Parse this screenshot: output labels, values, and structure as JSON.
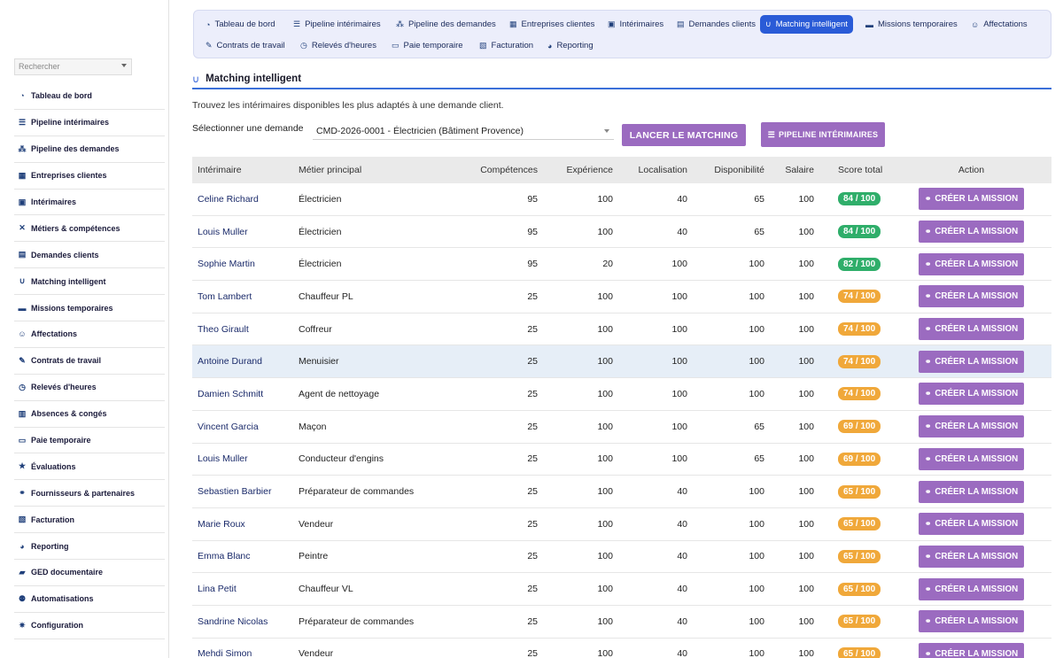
{
  "colors": {
    "accent": "#2a5bd7",
    "button": "#9b6bc0",
    "score_high": "#2fae6a",
    "score_mid": "#f0a83a"
  },
  "sidebar": {
    "search_placeholder": "Rechercher",
    "items": [
      {
        "label": "Tableau de bord",
        "icon": "dashboard-icon"
      },
      {
        "label": "Pipeline intérimaires",
        "icon": "list-icon"
      },
      {
        "label": "Pipeline des demandes",
        "icon": "flow-icon"
      },
      {
        "label": "Entreprises clientes",
        "icon": "building-icon"
      },
      {
        "label": "Intérimaires",
        "icon": "badge-icon"
      },
      {
        "label": "Métiers & compétences",
        "icon": "tools-icon"
      },
      {
        "label": "Demandes clients",
        "icon": "clipboard-icon"
      },
      {
        "label": "Matching intelligent",
        "icon": "magnet-icon"
      },
      {
        "label": "Missions temporaires",
        "icon": "briefcase-icon"
      },
      {
        "label": "Affectations",
        "icon": "user-plus-icon"
      },
      {
        "label": "Contrats de travail",
        "icon": "contract-icon"
      },
      {
        "label": "Relevés d'heures",
        "icon": "clock-icon"
      },
      {
        "label": "Absences & congés",
        "icon": "calendar-icon"
      },
      {
        "label": "Paie temporaire",
        "icon": "money-icon"
      },
      {
        "label": "Évaluations",
        "icon": "star-icon"
      },
      {
        "label": "Fournisseurs & partenaires",
        "icon": "handshake-icon"
      },
      {
        "label": "Facturation",
        "icon": "invoice-icon"
      },
      {
        "label": "Reporting",
        "icon": "pie-chart-icon"
      },
      {
        "label": "GED documentaire",
        "icon": "folder-icon"
      },
      {
        "label": "Automatisations",
        "icon": "robot-icon"
      },
      {
        "label": "Configuration",
        "icon": "gear-icon"
      }
    ]
  },
  "tabs": [
    {
      "label": "Tableau de bord",
      "icon": "dashboard-icon"
    },
    {
      "label": "Pipeline intérimaires",
      "icon": "list-icon"
    },
    {
      "label": "Pipeline des demandes",
      "icon": "flow-icon"
    },
    {
      "label": "Entreprises clientes",
      "icon": "building-icon"
    },
    {
      "label": "Intérimaires",
      "icon": "badge-icon"
    },
    {
      "label": "Demandes clients",
      "icon": "clipboard-icon"
    },
    {
      "label": "Matching intelligent",
      "icon": "magnet-icon",
      "active": true
    },
    {
      "label": "Missions temporaires",
      "icon": "briefcase-icon"
    },
    {
      "label": "Affectations",
      "icon": "user-plus-icon"
    },
    {
      "label": "Contrats de travail",
      "icon": "contract-icon"
    },
    {
      "label": "Relevés d'heures",
      "icon": "clock-icon"
    },
    {
      "label": "Paie temporaire",
      "icon": "money-icon"
    },
    {
      "label": "Facturation",
      "icon": "invoice-icon"
    },
    {
      "label": "Reporting",
      "icon": "pie-chart-icon"
    }
  ],
  "page": {
    "title": "Matching intelligent",
    "description": "Trouvez les intérimaires disponibles les plus adaptés à une demande client.",
    "select_label": "Sélectionner une demande",
    "select_value": "CMD-2026-0001 - Électricien (Bâtiment Provence)",
    "launch_button": "LANCER LE MATCHING",
    "pipeline_button": "PIPELINE INTÉRIMAIRES"
  },
  "table": {
    "headers": [
      "Intérimaire",
      "Métier principal",
      "Compétences",
      "Expérience",
      "Localisation",
      "Disponibilité",
      "Salaire",
      "Score total",
      "Action"
    ],
    "action_label": "CRÉER LA MISSION",
    "rows": [
      {
        "name": "Celine Richard",
        "job": "Électricien",
        "comp": "95",
        "exp": "100",
        "loc": "40",
        "dis": "65",
        "sal": "100",
        "score": "84 / 100",
        "level": "high"
      },
      {
        "name": "Louis Muller",
        "job": "Électricien",
        "comp": "95",
        "exp": "100",
        "loc": "40",
        "dis": "65",
        "sal": "100",
        "score": "84 / 100",
        "level": "high"
      },
      {
        "name": "Sophie Martin",
        "job": "Électricien",
        "comp": "95",
        "exp": "20",
        "loc": "100",
        "dis": "100",
        "sal": "100",
        "score": "82 / 100",
        "level": "high"
      },
      {
        "name": "Tom Lambert",
        "job": "Chauffeur PL",
        "comp": "25",
        "exp": "100",
        "loc": "100",
        "dis": "100",
        "sal": "100",
        "score": "74 / 100",
        "level": "mid"
      },
      {
        "name": "Theo Girault",
        "job": "Coffreur",
        "comp": "25",
        "exp": "100",
        "loc": "100",
        "dis": "100",
        "sal": "100",
        "score": "74 / 100",
        "level": "mid"
      },
      {
        "name": "Antoine Durand",
        "job": "Menuisier",
        "comp": "25",
        "exp": "100",
        "loc": "100",
        "dis": "100",
        "sal": "100",
        "score": "74 / 100",
        "level": "mid",
        "highlight": true
      },
      {
        "name": "Damien Schmitt",
        "job": "Agent de nettoyage",
        "comp": "25",
        "exp": "100",
        "loc": "100",
        "dis": "100",
        "sal": "100",
        "score": "74 / 100",
        "level": "mid"
      },
      {
        "name": "Vincent Garcia",
        "job": "Maçon",
        "comp": "25",
        "exp": "100",
        "loc": "100",
        "dis": "65",
        "sal": "100",
        "score": "69 / 100",
        "level": "mid"
      },
      {
        "name": "Louis Muller",
        "job": "Conducteur d'engins",
        "comp": "25",
        "exp": "100",
        "loc": "100",
        "dis": "65",
        "sal": "100",
        "score": "69 / 100",
        "level": "mid"
      },
      {
        "name": "Sebastien Barbier",
        "job": "Préparateur de commandes",
        "comp": "25",
        "exp": "100",
        "loc": "40",
        "dis": "100",
        "sal": "100",
        "score": "65 / 100",
        "level": "mid"
      },
      {
        "name": "Marie Roux",
        "job": "Vendeur",
        "comp": "25",
        "exp": "100",
        "loc": "40",
        "dis": "100",
        "sal": "100",
        "score": "65 / 100",
        "level": "mid"
      },
      {
        "name": "Emma Blanc",
        "job": "Peintre",
        "comp": "25",
        "exp": "100",
        "loc": "40",
        "dis": "100",
        "sal": "100",
        "score": "65 / 100",
        "level": "mid"
      },
      {
        "name": "Lina Petit",
        "job": "Chauffeur VL",
        "comp": "25",
        "exp": "100",
        "loc": "40",
        "dis": "100",
        "sal": "100",
        "score": "65 / 100",
        "level": "mid"
      },
      {
        "name": "Sandrine Nicolas",
        "job": "Préparateur de commandes",
        "comp": "25",
        "exp": "100",
        "loc": "40",
        "dis": "100",
        "sal": "100",
        "score": "65 / 100",
        "level": "mid"
      },
      {
        "name": "Mehdi Simon",
        "job": "Vendeur",
        "comp": "25",
        "exp": "100",
        "loc": "40",
        "dis": "100",
        "sal": "100",
        "score": "65 / 100",
        "level": "mid"
      }
    ]
  }
}
